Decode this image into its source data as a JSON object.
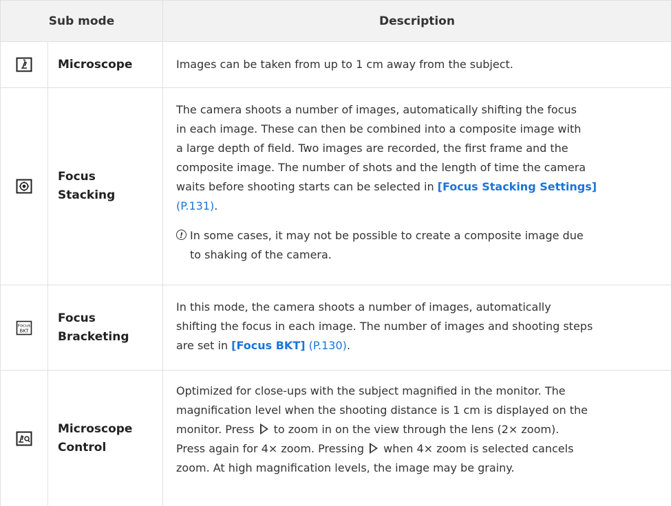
{
  "header": {
    "sub_mode": "Sub mode",
    "description": "Description"
  },
  "rows": [
    {
      "icon": "microscope-icon",
      "name": "Microscope",
      "desc": "Images can be taken from up to 1 cm away from the subject."
    },
    {
      "icon": "focus-stacking-icon",
      "name_line1": "Focus",
      "name_line2": "Stacking",
      "desc_lines": [
        "The camera shoots a number of images, automatically shifting the focus",
        "in each image. These can then be combined into a composite image with",
        "a large depth of field. Two images are recorded, the first frame and the",
        "composite image. The number of shots and the length of time the camera",
        "waits before shooting starts can be selected in "
      ],
      "link_label": "[Focus Stacking Settings]",
      "link_page": "(P.131)",
      "desc_end": ".",
      "caution_icon": "caution-icon",
      "caution_line1": "In some cases, it may not be possible to create a composite image due",
      "caution_line2": "to shaking of the camera."
    },
    {
      "icon": "focus-bkt-icon",
      "icon_text_top": "Focus",
      "icon_text_bottom": "BKT",
      "name_line1": "Focus",
      "name_line2": "Bracketing",
      "desc_lines": [
        "In this mode, the camera shoots a number of images, automatically",
        "shifting the focus in each image. The number of images and shooting steps",
        "are set in "
      ],
      "link_label": "[Focus BKT]",
      "link_page": "(P.130)",
      "desc_end": "."
    },
    {
      "icon": "microscope-control-icon",
      "name_line1": "Microscope",
      "name_line2": "Control",
      "desc_line1": "Optimized for close-ups with the subject magnified in the monitor. The",
      "desc_line2": "magnification level when the shooting distance is 1 cm is displayed on the",
      "desc_line3a": "monitor. Press ",
      "desc_line3b": " to zoom in on the view through the lens (2× zoom).",
      "desc_line4a": "Press again for 4× zoom. Pressing ",
      "desc_line4b": " when 4× zoom is selected cancels",
      "desc_line5": "zoom. At high magnification levels, the image may be grainy.",
      "arrow_icon": "right-triangle-icon"
    }
  ]
}
